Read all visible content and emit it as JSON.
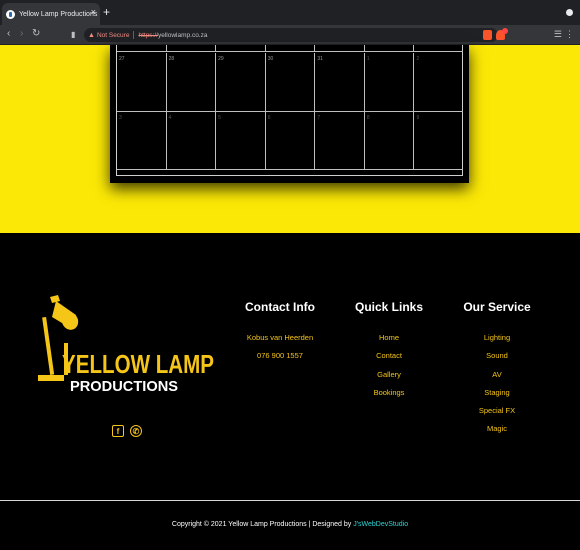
{
  "browser": {
    "tab_title": "Yellow Lamp Productions",
    "tab_close": "×",
    "new_tab": "+",
    "back": "‹",
    "forward": "›",
    "reload": "↻",
    "bookmark": "▮",
    "security_icon": "▲",
    "security_text": "Not Secure",
    "url_scheme": "https://",
    "url_host": "yellowlamp.co.za",
    "menu": "⋮",
    "queue": "☰",
    "rewards_count": "5"
  },
  "calendar": {
    "rows": [
      [
        "27",
        "28",
        "29",
        "30",
        "31",
        "1",
        "2"
      ],
      [
        "3",
        "4",
        "5",
        "6",
        "7",
        "8",
        "9"
      ]
    ]
  },
  "footer": {
    "logo": {
      "line1": "YELLOW LAMP",
      "line2": "PRODUCTIONS"
    },
    "social": {
      "facebook": "f",
      "whatsapp": "✆"
    },
    "contact": {
      "heading": "Contact Info",
      "name": "Kobus van Heerden",
      "phone": "076 900 1557"
    },
    "quick_links": {
      "heading": "Quick Links",
      "items": [
        "Home",
        "Contact",
        "Gallery",
        "Bookings"
      ]
    },
    "service": {
      "heading": "Our Service",
      "items": [
        "Lighting",
        "Sound",
        "AV",
        "Staging",
        "Special FX",
        "Magic"
      ]
    },
    "copyright": "Copyright © 2021 Yellow Lamp Productions | Designed by ",
    "designer": "J'sWebDevStudio"
  },
  "colors": {
    "accent": "#f5c518",
    "page_yellow": "#fbe806",
    "designer_link": "#2cd6d6"
  }
}
